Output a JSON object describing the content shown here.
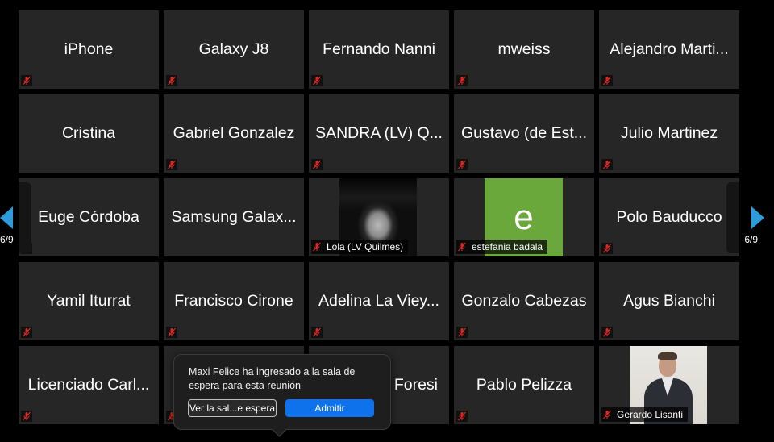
{
  "participants": [
    {
      "name": "iPhone",
      "type": "name"
    },
    {
      "name": "Galaxy J8",
      "type": "name"
    },
    {
      "name": "Fernando Nanni",
      "type": "name"
    },
    {
      "name": "mweiss",
      "type": "name"
    },
    {
      "name": "Alejandro Marti...",
      "type": "name"
    },
    {
      "name": "Cristina",
      "type": "name",
      "muted": false
    },
    {
      "name": "Gabriel Gonzalez",
      "type": "name"
    },
    {
      "name": "SANDRA (LV) Q...",
      "type": "name"
    },
    {
      "name": "Gustavo (de Est...",
      "type": "name"
    },
    {
      "name": "Julio Martinez",
      "type": "name"
    },
    {
      "name": "Euge Córdoba",
      "type": "name"
    },
    {
      "name": "Samsung Galax...",
      "type": "name",
      "muted": false
    },
    {
      "name": "Lola (LV Quilmes)",
      "type": "photo"
    },
    {
      "name": "estefania badala",
      "type": "avatar",
      "initial": "e",
      "color": "#6aa83b"
    },
    {
      "name": "Polo Bauducco",
      "type": "name"
    },
    {
      "name": "Yamil Iturrat",
      "type": "name"
    },
    {
      "name": "Francisco Cirone",
      "type": "name"
    },
    {
      "name": "Adelina La Viey...",
      "type": "name"
    },
    {
      "name": "Gonzalo Cabezas",
      "type": "name"
    },
    {
      "name": "Agus Bianchi",
      "type": "name"
    },
    {
      "name": "Licenciado Carl...",
      "type": "name"
    },
    {
      "name": "",
      "type": "name"
    },
    {
      "name": "Foresi",
      "type": "name"
    },
    {
      "name": "Pablo Pelizza",
      "type": "name"
    },
    {
      "name": "Gerardo Lisanti",
      "type": "photo"
    }
  ],
  "pagination": {
    "left": "6/9",
    "right": "6/9"
  },
  "notification": {
    "message": "Maxi Felice ha ingresado a la sala de espera para esta reunión",
    "view_label": "Ver la sal...e espera",
    "admit_label": "Admitir"
  },
  "colors": {
    "accent": "#0e72ed",
    "muted_icon": "#e0281f",
    "tile": "#262626",
    "nav_arrow": "#2d9cdb"
  }
}
